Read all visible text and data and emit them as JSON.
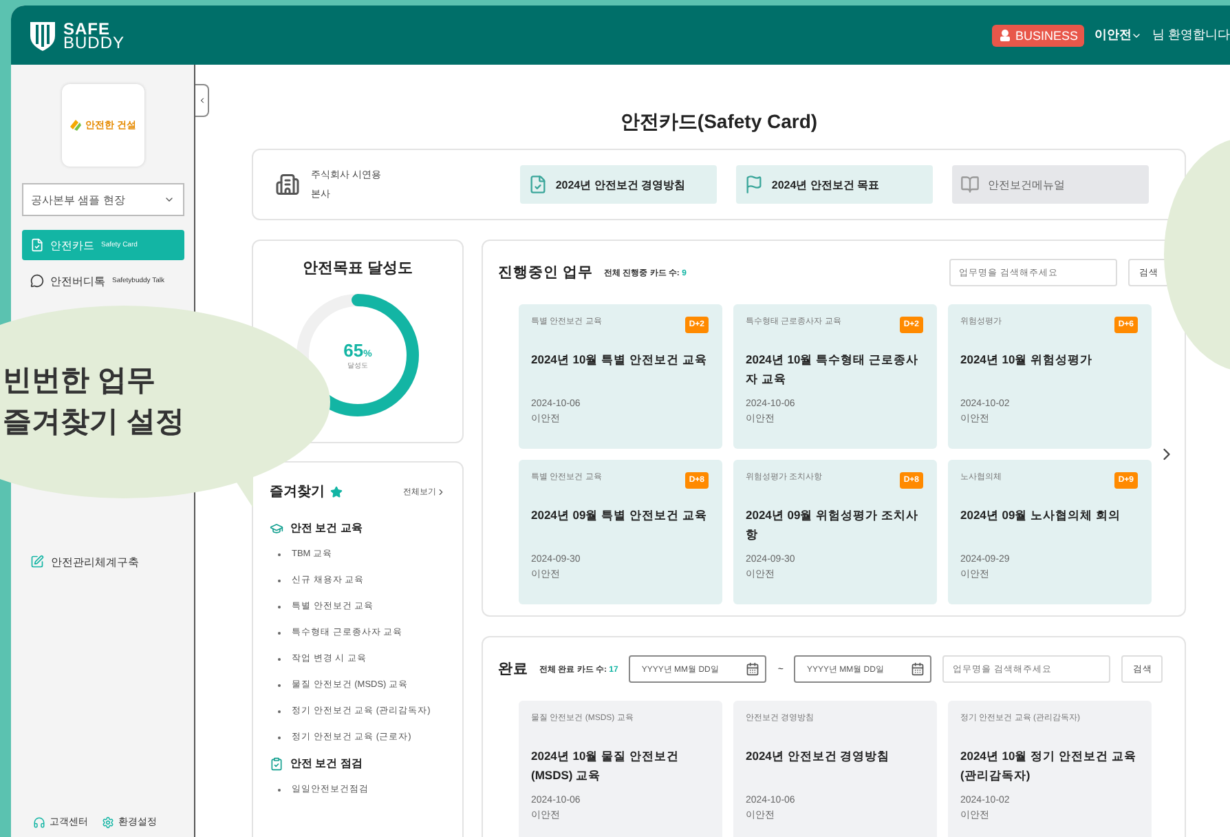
{
  "header": {
    "logo_top": "SAFE",
    "logo_bottom": "BUDDY",
    "badge": "BUSINESS",
    "user": "이안전",
    "greeting": "님 환영합니다"
  },
  "sidebar": {
    "company_logo": "안전한 건설",
    "site_select": "공사본부 샘플 현장",
    "items": [
      {
        "label": "안전카드",
        "sub": "Safety Card",
        "selected": true
      },
      {
        "label": "안전버디톡",
        "sub": "Safetybuddy Talk",
        "selected": false
      }
    ],
    "lower_items": [
      {
        "label": "안전관리체계구축",
        "selected": false
      }
    ],
    "footer": [
      "고객센터",
      "환경설정"
    ]
  },
  "page_title": "안전카드(Safety Card)",
  "company": {
    "name": "주식회사 시연용",
    "branch": "본사"
  },
  "quick_buttons": [
    {
      "label": "2024년 안전보건 경영방침",
      "disabled": false
    },
    {
      "label": "2024년 안전보건 목표",
      "disabled": false
    },
    {
      "label": "안전보건메뉴얼",
      "disabled": true
    }
  ],
  "goal": {
    "title": "안전목표 달성도",
    "value": "65",
    "unit": "%",
    "caption": "달성도",
    "level": 0.65
  },
  "favorites": {
    "title": "즐겨찾기",
    "view_all": "전체보기",
    "groups": [
      {
        "title": "안전 보건 교육",
        "items": [
          "TBM 교육",
          "신규 채용자 교육",
          "특별 안전보건 교육",
          "특수형태 근로종사자 교육",
          "작업 변경 시 교육",
          "물질 안전보건 (MSDS) 교육",
          "정기 안전보건 교육 (관리감독자)",
          "정기 안전보건 교육 (근로자)"
        ]
      },
      {
        "title": "안전 보건 점검",
        "items": [
          "일일안전보건점검"
        ]
      }
    ]
  },
  "in_progress": {
    "title": "진행중인 업무",
    "count_label": "전체 진행중 카드 수:",
    "count": "9",
    "search_placeholder": "업무명을 검색해주세요",
    "search_button": "검색",
    "cards": [
      {
        "category": "특별 안전보건 교육",
        "badge": "D+2",
        "title": "2024년 10월 특별 안전보건 교육",
        "date": "2024-10-06",
        "author": "이안전"
      },
      {
        "category": "특수형태 근로종사자 교육",
        "badge": "D+2",
        "title": "2024년 10월 특수형태 근로종사자 교육",
        "date": "2024-10-06",
        "author": "이안전"
      },
      {
        "category": "위험성평가",
        "badge": "D+6",
        "title": "2024년 10월 위험성평가",
        "date": "2024-10-02",
        "author": "이안전"
      },
      {
        "category": "특별 안전보건 교육",
        "badge": "D+8",
        "title": "2024년 09월 특별 안전보건 교육",
        "date": "2024-09-30",
        "author": "이안전"
      },
      {
        "category": "위험성평가 조치사항",
        "badge": "D+8",
        "title": "2024년 09월 위험성평가 조치사항",
        "date": "2024-09-30",
        "author": "이안전"
      },
      {
        "category": "노사협의체",
        "badge": "D+9",
        "title": "2024년 09월 노사협의체 회의",
        "date": "2024-09-29",
        "author": "이안전"
      }
    ]
  },
  "completed": {
    "title": "완료",
    "count_label": "전체 완료 카드 수:",
    "count": "17",
    "date_placeholder_from": "YYYY년 MM월 DD일",
    "range_sep": "~",
    "date_placeholder_to": "YYYY년 MM월 DD일",
    "search_placeholder": "업무명을 검색해주세요",
    "search_button": "검색",
    "cards": [
      {
        "category": "물질 안전보건 (MSDS) 교육",
        "title": "2024년 10월 물질 안전보건 (MSDS) 교육",
        "date": "2024-10-06",
        "author": "이안전"
      },
      {
        "category": "안전보건 경영방침",
        "title": "2024년 안전보건 경영방침",
        "date": "2024-10-06",
        "author": "이안전"
      },
      {
        "category": "정기 안전보건 교육 (관리감독자)",
        "title": "2024년 10월 정기 안전보건 교육 (관리감독자)",
        "date": "2024-10-02",
        "author": "이안전"
      }
    ]
  },
  "callout": {
    "lines": [
      "빈번한 업무",
      "즐겨찾기 설정"
    ]
  }
}
